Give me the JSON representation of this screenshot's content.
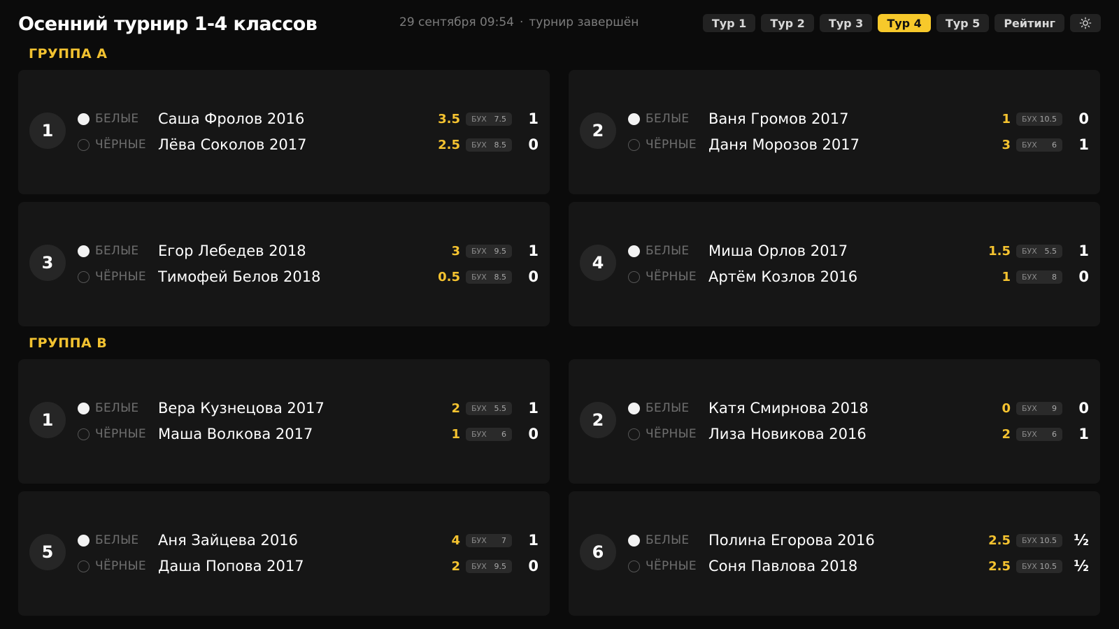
{
  "header": {
    "title": "Осенний турнир 1-4 классов",
    "datetime": "29 сентября 09:54",
    "separator": "·",
    "status": "турнир завершён",
    "tabs": [
      {
        "label": "Тур 1"
      },
      {
        "label": "Тур 2"
      },
      {
        "label": "Тур 3"
      },
      {
        "label": "Тур 4",
        "active": true
      },
      {
        "label": "Тур 5"
      },
      {
        "label": "Рейтинг"
      }
    ],
    "theme_icon": "sun-icon"
  },
  "labels": {
    "white": "БЕЛЫЕ",
    "black": "ЧЁРНЫЕ",
    "buchholz": "БУХ"
  },
  "colors": {
    "accent": "#f7c92b",
    "group_title": "#f2c230",
    "background": "#0b0b0b",
    "card": "#161616"
  },
  "groups": [
    {
      "title": "ГРУППА А",
      "boards": [
        {
          "board": "1",
          "white": {
            "name": "Саша Фролов 2016",
            "points": "3.5",
            "buch": "7.5",
            "result": "1"
          },
          "black": {
            "name": "Лёва Соколов 2017",
            "points": "2.5",
            "buch": "8.5",
            "result": "0"
          }
        },
        {
          "board": "2",
          "white": {
            "name": "Ваня Громов 2017",
            "points": "1",
            "buch": "10.5",
            "result": "0"
          },
          "black": {
            "name": "Даня Морозов 2017",
            "points": "3",
            "buch": "6",
            "result": "1"
          }
        },
        {
          "board": "3",
          "white": {
            "name": "Егор Лебедев 2018",
            "points": "3",
            "buch": "9.5",
            "result": "1"
          },
          "black": {
            "name": "Тимофей Белов 2018",
            "points": "0.5",
            "buch": "8.5",
            "result": "0"
          }
        },
        {
          "board": "4",
          "white": {
            "name": "Миша Орлов 2017",
            "points": "1.5",
            "buch": "5.5",
            "result": "1"
          },
          "black": {
            "name": "Артём Козлов 2016",
            "points": "1",
            "buch": "8",
            "result": "0"
          }
        }
      ]
    },
    {
      "title": "ГРУППА В",
      "boards": [
        {
          "board": "1",
          "white": {
            "name": "Вера Кузнецова 2017",
            "points": "2",
            "buch": "5.5",
            "result": "1"
          },
          "black": {
            "name": "Маша Волкова 2017",
            "points": "1",
            "buch": "6",
            "result": "0"
          }
        },
        {
          "board": "2",
          "white": {
            "name": "Катя Смирнова 2018",
            "points": "0",
            "buch": "9",
            "result": "0"
          },
          "black": {
            "name": "Лиза Новикова 2016",
            "points": "2",
            "buch": "6",
            "result": "1"
          }
        },
        {
          "board": "5",
          "white": {
            "name": "Аня Зайцева 2016",
            "points": "4",
            "buch": "7",
            "result": "1"
          },
          "black": {
            "name": "Даша Попова 2017",
            "points": "2",
            "buch": "9.5",
            "result": "0"
          }
        },
        {
          "board": "6",
          "white": {
            "name": "Полина Егорова 2016",
            "points": "2.5",
            "buch": "10.5",
            "result": "½"
          },
          "black": {
            "name": "Соня Павлова 2018",
            "points": "2.5",
            "buch": "10.5",
            "result": "½"
          }
        }
      ]
    }
  ]
}
